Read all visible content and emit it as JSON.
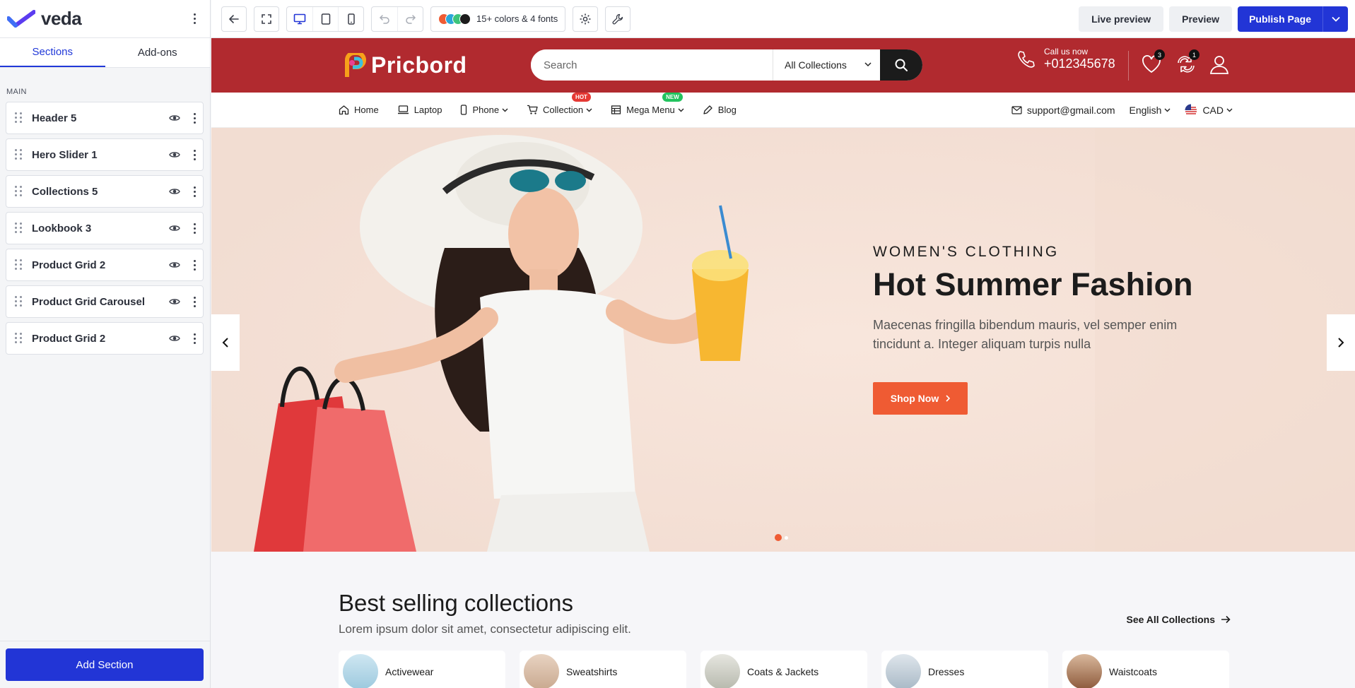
{
  "app": {
    "name": "veda"
  },
  "sidebar": {
    "tabs": [
      {
        "label": "Sections"
      },
      {
        "label": "Add-ons"
      }
    ],
    "group_label": "MAIN",
    "items": [
      {
        "label": "Header 5"
      },
      {
        "label": "Hero Slider 1"
      },
      {
        "label": "Collections 5"
      },
      {
        "label": "Lookbook 3"
      },
      {
        "label": "Product Grid 2"
      },
      {
        "label": "Product Grid Carousel"
      },
      {
        "label": "Product Grid 2"
      }
    ],
    "add_button": "Add Section"
  },
  "toolbar": {
    "theme_label": "15+ colors & 4 fonts",
    "theme_colors": [
      "#ef5b33",
      "#2aa7d8",
      "#3cc47c",
      "#1c1c1c"
    ],
    "live_preview": "Live preview",
    "preview": "Preview",
    "publish": "Publish Page"
  },
  "site": {
    "brand": "Pricbord",
    "search_placeholder": "Search",
    "search_category": "All Collections",
    "call_label": "Call us now",
    "call_number": "+012345678",
    "wishlist_count": "3",
    "compare_count": "1",
    "nav": [
      {
        "label": "Home"
      },
      {
        "label": "Laptop"
      },
      {
        "label": "Phone"
      },
      {
        "label": "Collection",
        "tag": "HOT"
      },
      {
        "label": "Mega Menu",
        "tag": "NEW"
      },
      {
        "label": "Blog"
      }
    ],
    "email": "support@gmail.com",
    "language": "English",
    "currency": "CAD",
    "colors": {
      "header": "#b12a2f",
      "accent": "#ef5b33",
      "hot": "#e53935",
      "new": "#22c35e"
    }
  },
  "hero": {
    "eyebrow": "WOMEN'S CLOTHING",
    "title": "Hot Summer Fashion",
    "description": "Maecenas fringilla bibendum mauris, vel semper enim tincidunt a. Integer aliquam turpis nulla",
    "cta": "Shop Now"
  },
  "collections": {
    "title": "Best selling collections",
    "subtitle": "Lorem ipsum dolor sit amet, consectetur adipiscing elit.",
    "see_all": "See All Collections",
    "items": [
      {
        "label": "Activewear"
      },
      {
        "label": "Sweatshirts"
      },
      {
        "label": "Coats & Jackets"
      },
      {
        "label": "Dresses"
      },
      {
        "label": "Waistcoats"
      }
    ]
  }
}
